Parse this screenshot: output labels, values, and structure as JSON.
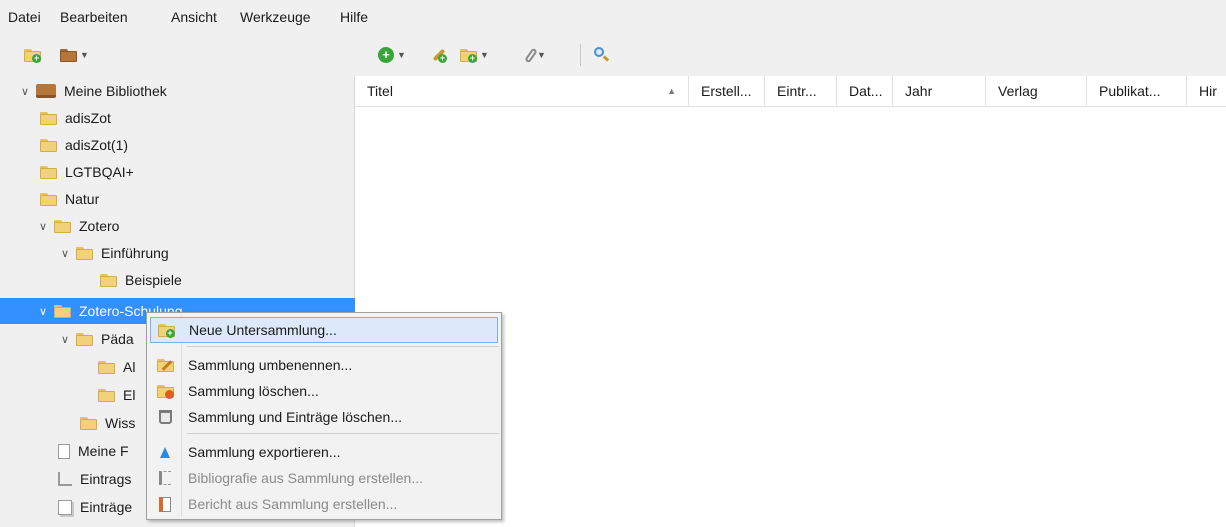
{
  "menubar": {
    "items": [
      {
        "label": "Datei"
      },
      {
        "label": "Bearbeiten"
      },
      {
        "label": "Ansicht"
      },
      {
        "label": "Werkzeuge"
      },
      {
        "label": "Hilfe"
      }
    ]
  },
  "toolbar": {
    "icons": [
      "new-collection-icon",
      "new-library-icon",
      "new-item-icon",
      "add-by-identifier-icon",
      "new-note-icon",
      "attachment-icon",
      "search-icon"
    ]
  },
  "tree": {
    "items": [
      {
        "label": "Meine Bibliothek",
        "icon": "library-icon"
      },
      {
        "label": "adisZot",
        "icon": "folder-icon"
      },
      {
        "label": "adisZot(1)",
        "icon": "folder-icon"
      },
      {
        "label": "LGTBQAI+",
        "icon": "folder-icon"
      },
      {
        "label": "Natur",
        "icon": "folder-icon"
      },
      {
        "label": "Zotero",
        "icon": "folder-icon"
      },
      {
        "label": "Einführung",
        "icon": "folder-icon"
      },
      {
        "label": "Beispiele",
        "icon": "folder-icon"
      },
      {
        "label": "Zotero-Schulung",
        "icon": "folder-icon"
      },
      {
        "label": "Päda",
        "icon": "folder-icon"
      },
      {
        "label": "Al",
        "icon": "folder-icon"
      },
      {
        "label": "El",
        "icon": "folder-icon"
      },
      {
        "label": "Wiss",
        "icon": "folder-icon"
      },
      {
        "label": "Meine F",
        "icon": "document-icon"
      },
      {
        "label": "Eintrags",
        "icon": "hierarchy-icon"
      },
      {
        "label": "Einträge",
        "icon": "duplicate-icon"
      }
    ]
  },
  "columns": [
    {
      "label": "Titel"
    },
    {
      "label": "Erstell..."
    },
    {
      "label": "Eintr..."
    },
    {
      "label": "Dat..."
    },
    {
      "label": "Jahr"
    },
    {
      "label": "Verlag"
    },
    {
      "label": "Publikat..."
    },
    {
      "label": "Hir"
    }
  ],
  "context_menu": {
    "items": [
      {
        "label": "Neue Untersammlung...",
        "state": "highlighted"
      },
      {
        "label": "Sammlung umbenennen..."
      },
      {
        "label": "Sammlung löschen..."
      },
      {
        "label": "Sammlung und Einträge löschen..."
      },
      {
        "label": "Sammlung exportieren..."
      },
      {
        "label": "Bibliografie aus Sammlung erstellen...",
        "state": "disabled"
      },
      {
        "label": "Bericht aus Sammlung erstellen...",
        "state": "disabled"
      }
    ]
  },
  "colors": {
    "selection": "#3390ff",
    "chrome": "#f0f0f0",
    "folder": "#f1d27a",
    "menu_highlight": "#dbe9f9"
  }
}
